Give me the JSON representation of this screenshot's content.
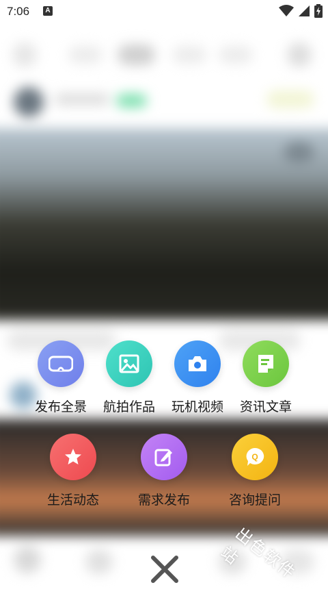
{
  "status_bar": {
    "time": "7:06",
    "notification_icon_letter": "A",
    "icons": [
      "wifi-icon",
      "signal-icon",
      "battery-charging-icon"
    ]
  },
  "menu": {
    "row1": [
      {
        "label": "发布全景",
        "icon": "vr-glasses-icon",
        "color": "#7f8ef0"
      },
      {
        "label": "航拍作品",
        "icon": "image-icon",
        "color": "#3fd3c0"
      },
      {
        "label": "玩机视频",
        "icon": "camera-icon",
        "color": "#3a8ff2"
      },
      {
        "label": "资讯文章",
        "icon": "document-icon",
        "color": "#7fd04e"
      }
    ],
    "row2": [
      {
        "label": "生活动态",
        "icon": "star-icon",
        "color": "#f2585c"
      },
      {
        "label": "需求发布",
        "icon": "edit-icon",
        "color": "#b06cf2"
      },
      {
        "label": "咨询提问",
        "icon": "question-bubble-icon",
        "color": "#f7c21f"
      }
    ]
  },
  "close_icon": "close-icon",
  "watermark": "出色软件站"
}
